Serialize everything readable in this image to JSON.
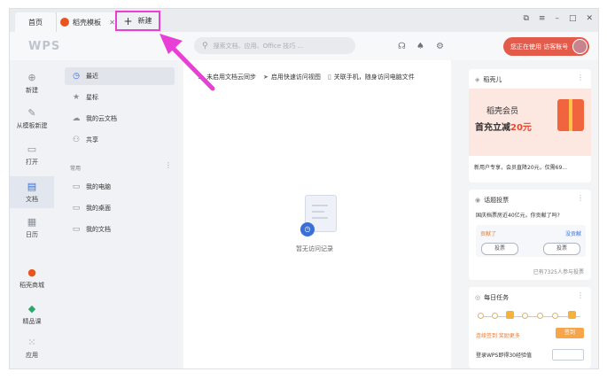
{
  "tabs": {
    "home": "首页",
    "template": "稻壳模板",
    "new": "新建"
  },
  "window_controls": {
    "restore": "⧉",
    "menu": "≡",
    "minimize": "–",
    "maximize": "□",
    "close": "✕"
  },
  "toolbar": {
    "logo": "WPS",
    "search_placeholder": "搜索文档、应用、Office 技巧 ...",
    "account_text": "您正在使用 访客账号"
  },
  "left_nav": [
    {
      "label": "新建"
    },
    {
      "label": "从模板新建"
    },
    {
      "label": "打开"
    },
    {
      "label": "文档"
    },
    {
      "label": "日历"
    },
    {
      "label": "稻壳商城"
    },
    {
      "label": "精品课"
    },
    {
      "label": "应用"
    }
  ],
  "second_nav": {
    "items": [
      {
        "label": "最近"
      },
      {
        "label": "星标"
      },
      {
        "label": "我的云文档"
      },
      {
        "label": "共享"
      }
    ],
    "section": "常用",
    "common": [
      {
        "label": "我的电脑"
      },
      {
        "label": "我的桌面"
      },
      {
        "label": "我的文档"
      }
    ]
  },
  "main": {
    "tips": [
      "未启用文档云同步",
      "启用快速访问视图",
      "关联手机，随身访问电脑文件"
    ],
    "empty": "暂无访问记录"
  },
  "right": {
    "promo": {
      "header": "稻壳儿",
      "t1": "稻壳会员",
      "t2a": "首充立减",
      "t2b": "20元",
      "sub": "新用户专享，会员直降20元，仅需69..."
    },
    "vote": {
      "header": "话题投票",
      "question": "国庆档票房近40亿元，你贡献了吗?",
      "left": "贡献了",
      "right": "没贡献",
      "btn": "投票",
      "count": "已有7325人参与投票"
    },
    "task": {
      "header": "每日任务",
      "line": "连续签到 奖励更多",
      "btn": "签到",
      "line2": "登录WPS即得30经验值"
    }
  },
  "colors": {
    "accent_blue": "#2f6fe0",
    "account_red": "#e25b4b",
    "highlight_magenta": "#e83fd6"
  }
}
